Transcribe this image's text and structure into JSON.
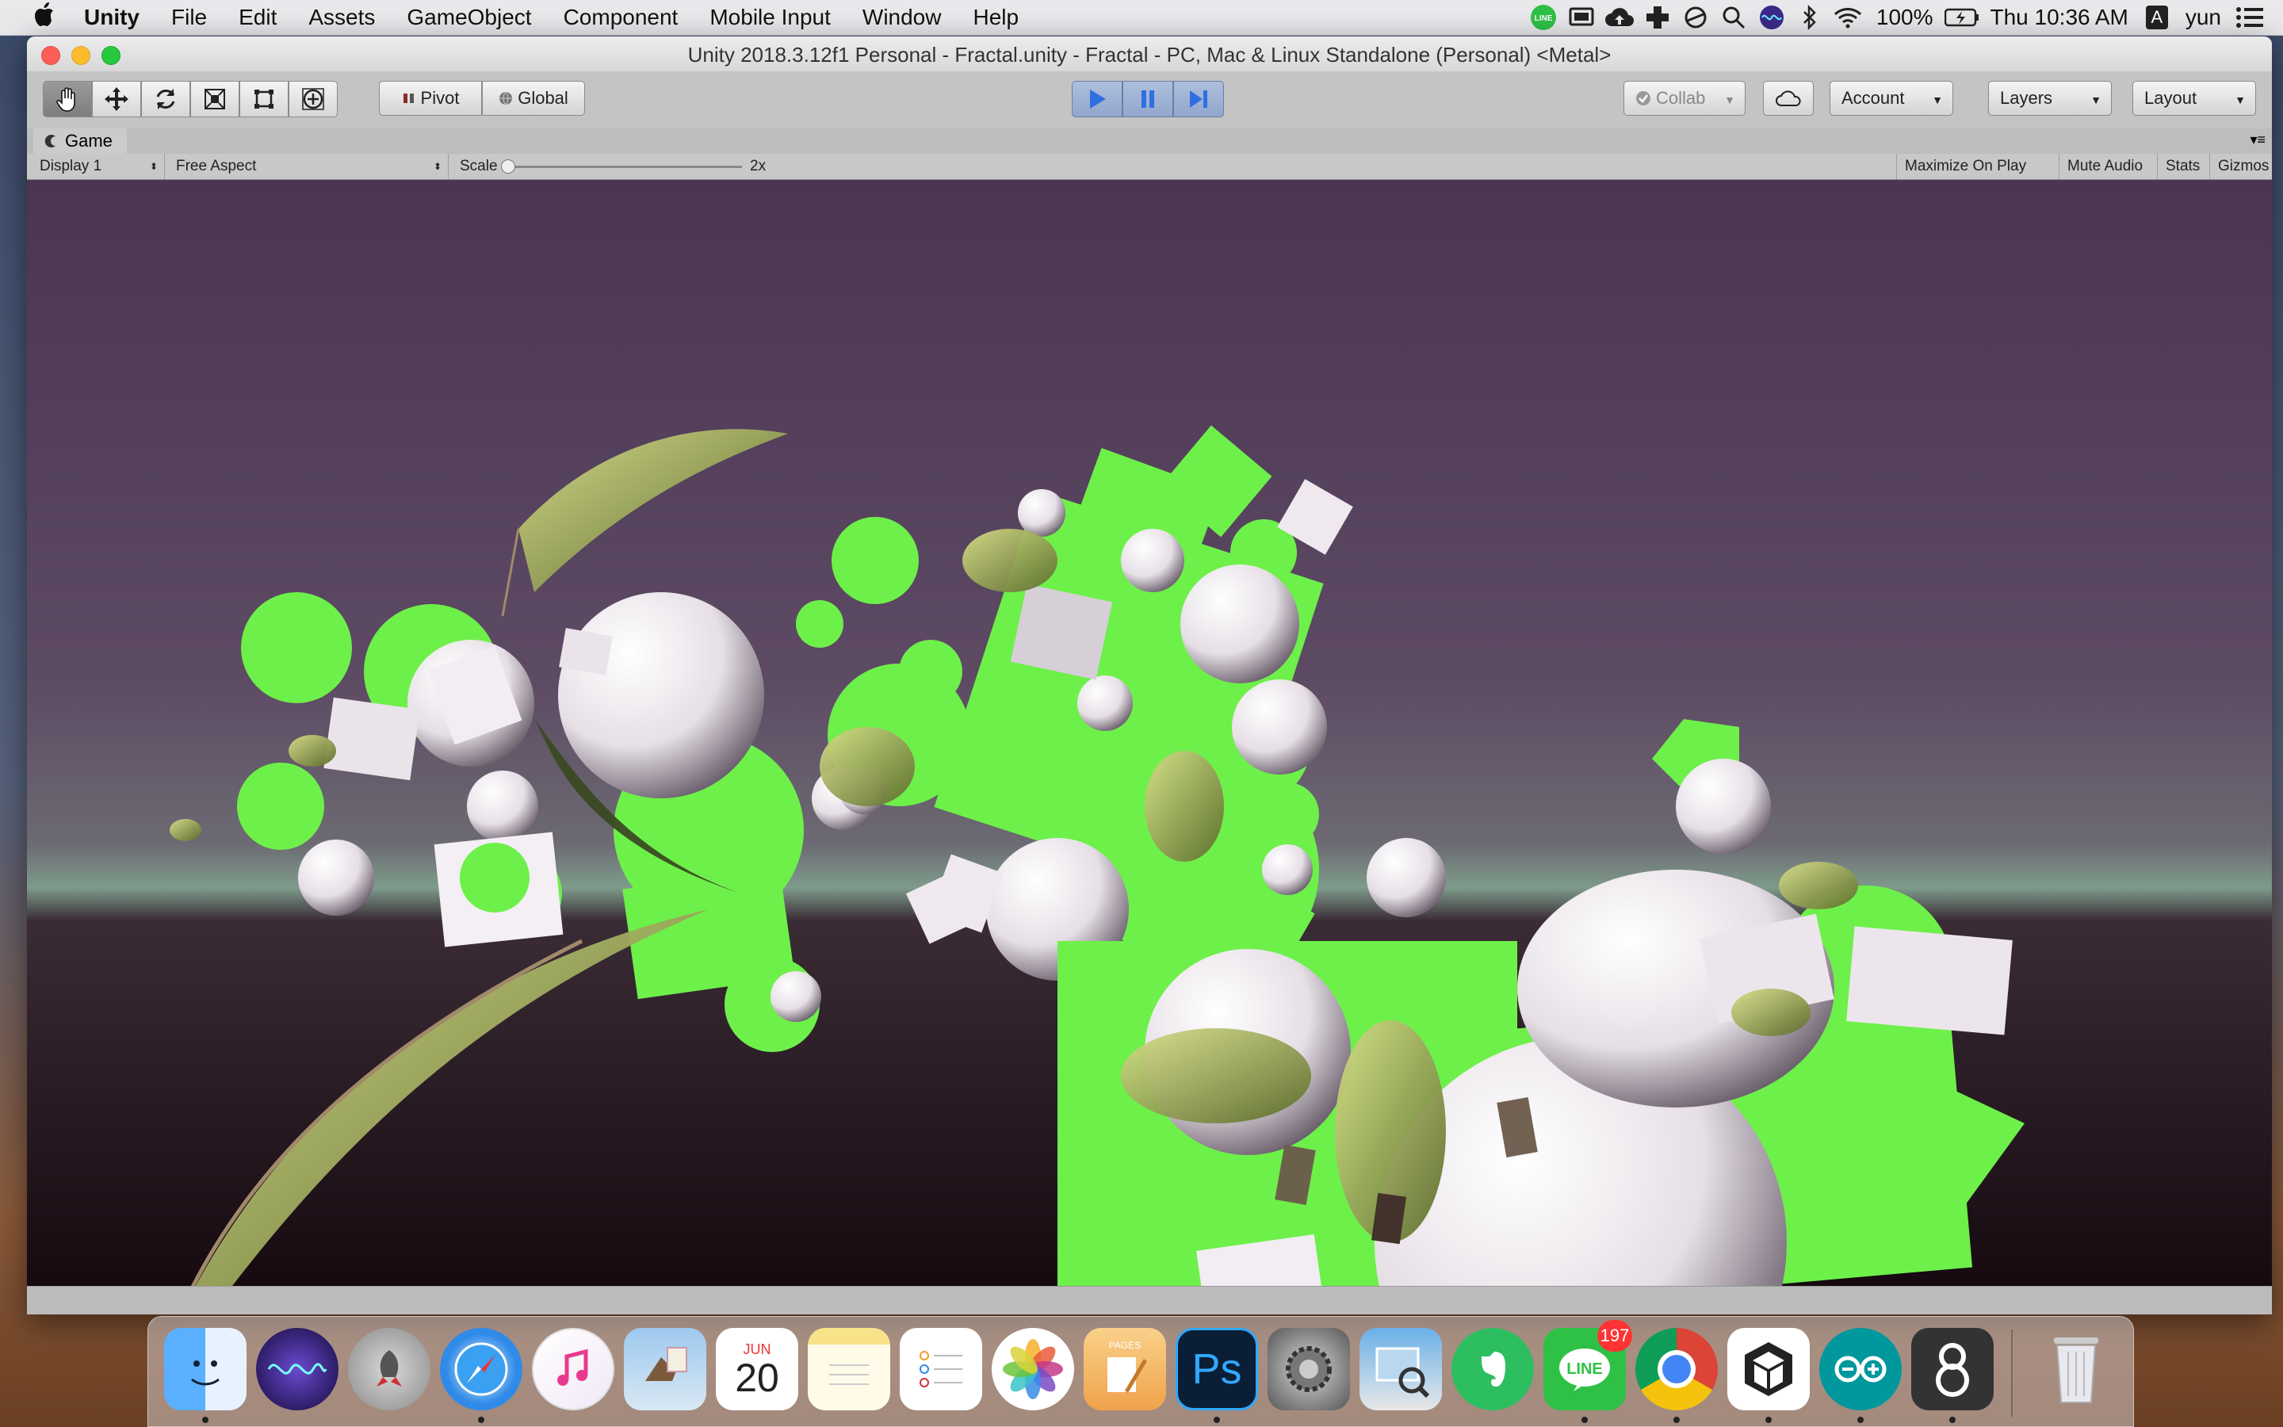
{
  "menubar": {
    "app_name": "Unity",
    "items": [
      "File",
      "Edit",
      "Assets",
      "GameObject",
      "Component",
      "Mobile Input",
      "Window",
      "Help"
    ],
    "battery": "100%",
    "clock": "Thu 10:36 AM",
    "input_source": "A",
    "user": "yun"
  },
  "window": {
    "title": "Unity 2018.3.12f1 Personal - Fractal.unity - Fractal - PC, Mac & Linux Standalone (Personal) <Metal>"
  },
  "toolbar": {
    "pivot_label": "Pivot",
    "global_label": "Global",
    "collab_label": "Collab",
    "account_label": "Account",
    "layers_label": "Layers",
    "layout_label": "Layout"
  },
  "game_tab": {
    "label": "Game",
    "display": "Display 1",
    "aspect": "Free Aspect",
    "scale_label": "Scale",
    "scale_value": "2x",
    "maximize_label": "Maximize On Play",
    "mute_label": "Mute Audio",
    "stats_label": "Stats",
    "gizmos_label": "Gizmos"
  },
  "dock": {
    "calendar_month": "JUN",
    "calendar_day": "20",
    "line_badge": "197",
    "pages_label": "PAGES",
    "photoshop_label": "Ps",
    "apps": [
      "finder-icon",
      "siri-icon",
      "launchpad-icon",
      "safari-icon",
      "itunes-icon",
      "mail-icon",
      "calendar-icon",
      "notes-icon",
      "reminders-icon",
      "photos-icon",
      "pages-icon",
      "photoshop-icon",
      "system-preferences-icon",
      "preview-icon",
      "evernote-icon",
      "line-icon",
      "chrome-icon",
      "unity-icon",
      "arduino-icon",
      "eight-icon",
      "trash-icon"
    ]
  },
  "colors": {
    "play_blue": "#2f6fe0",
    "fractal_green": "#6ef04a",
    "sky_top": "#4a3553",
    "sky_horizon": "#6e8f80",
    "ground": "#1d0f16"
  }
}
